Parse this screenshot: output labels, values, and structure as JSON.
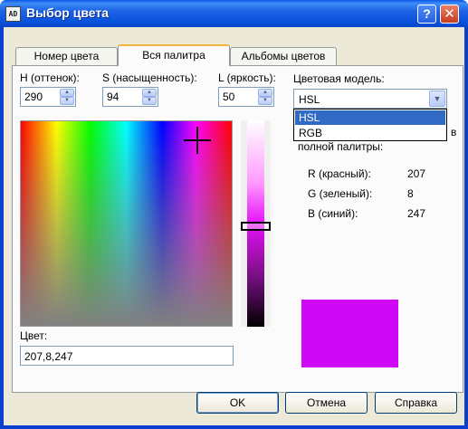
{
  "window": {
    "title": "Выбор цвета",
    "icon": "app-icon",
    "help_glyph": "?",
    "close_glyph": "✕"
  },
  "tabs": [
    {
      "label": "Номер цвета"
    },
    {
      "label": "Вся палитра",
      "active": true
    },
    {
      "label": "Альбомы цветов"
    }
  ],
  "fields": {
    "h_label": "H (оттенок):",
    "h_value": "290",
    "s_label": "S (насыщенность):",
    "s_value": "94",
    "l_label": "L (яркость):",
    "l_value": "50"
  },
  "color_model": {
    "label": "Цветовая модель:",
    "selected": "HSL",
    "options": [
      "HSL",
      "RGB"
    ],
    "note": "полной палитры:",
    "note_tail": "в"
  },
  "rgb": {
    "r_label": "R (красный):",
    "r_value": "207",
    "g_label": "G (зеленый):",
    "g_value": "8",
    "b_label": "B (синий):",
    "b_value": "247"
  },
  "color": {
    "label": "Цвет:",
    "value": "207,8,247",
    "swatch_hex": "#cf08f7"
  },
  "buttons": {
    "ok": "OK",
    "cancel": "Отмена",
    "help": "Справка"
  }
}
